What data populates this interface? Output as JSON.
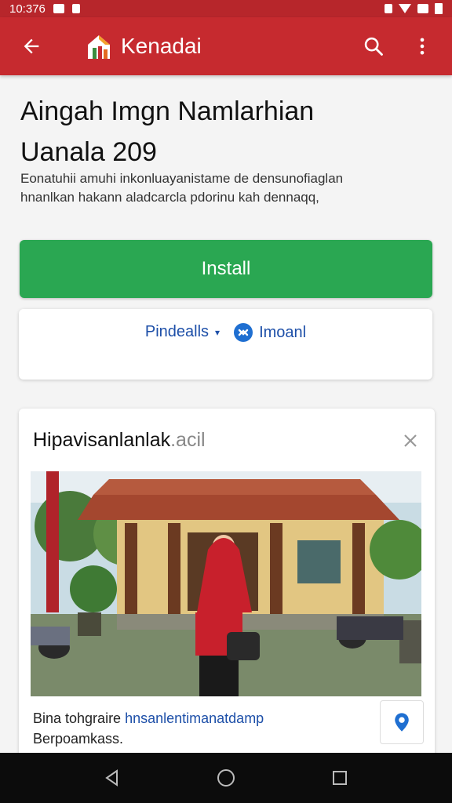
{
  "status_bar": {
    "time": "10:376"
  },
  "app_bar": {
    "title": "Kenadai"
  },
  "article": {
    "title_line1": "Aingah Imgn Namlarhian",
    "title_line2": "Uanala 209",
    "desc_line1": "Eonatuhii amuhi inkonluayanistame de densunofiaglan",
    "desc_line2": "hnanlkan hakann aladcarcla pdorinu kah dennaqq,"
  },
  "install_button": {
    "label": "Install"
  },
  "options": {
    "details_label": "Pindealls",
    "share_label": "Imoanl"
  },
  "news_card": {
    "title": "Hipavisanlanlak",
    "title_suffix": ".acil",
    "caption_line1_prefix": "Bina tohgraire ",
    "caption_line1_link": "hnsanlentimanatdamp",
    "caption_line2": "Berpoamkass."
  },
  "colors": {
    "app_bar": "#c62a2f",
    "status_bar": "#b7262b",
    "install": "#2aa752",
    "link": "#1d4fa8"
  },
  "icons": {
    "back": "arrow-left-icon",
    "logo": "house-logo-icon",
    "search": "search-icon",
    "more": "more-vert-icon",
    "share": "share-icon",
    "close": "close-icon",
    "pin": "location-pin-icon",
    "nav_back": "triangle-back-icon",
    "nav_home": "circle-home-icon",
    "nav_recents": "square-recents-icon"
  }
}
